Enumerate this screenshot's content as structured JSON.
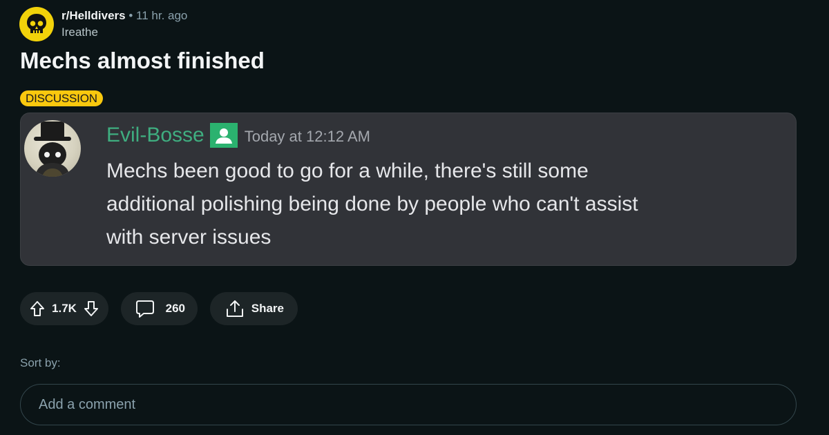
{
  "post": {
    "subreddit": "r/Helldivers",
    "separator": "•",
    "time_ago": "11 hr. ago",
    "author": "Ireathe",
    "title": "Mechs almost finished",
    "flair": "DISCUSSION"
  },
  "embed": {
    "username": "Evil-Bosse",
    "timestamp": "Today at 12:12 AM",
    "message_lines": [
      "Mechs been good to go for a while, there's still some",
      "additional polishing being done by people who can't assist",
      "with server issues"
    ]
  },
  "actions": {
    "vote_count": "1.7K",
    "comment_count": "260",
    "share_label": "Share"
  },
  "comments": {
    "sort_label": "Sort by:",
    "input_placeholder": "Add a comment"
  },
  "colors": {
    "background": "#0b1416",
    "flair_bg": "#f9c80e",
    "subreddit_icon_bg": "#f2d20a",
    "discord_bg": "#313338",
    "discord_username": "#3fae80",
    "pill_bg": "#1d2527"
  },
  "icons": {
    "subreddit": "skull-icon",
    "upvote": "upvote-arrow-icon",
    "downvote": "downvote-arrow-icon",
    "comment": "speech-bubble-icon",
    "share": "share-icon",
    "discord_badge": "member-badge-icon"
  }
}
